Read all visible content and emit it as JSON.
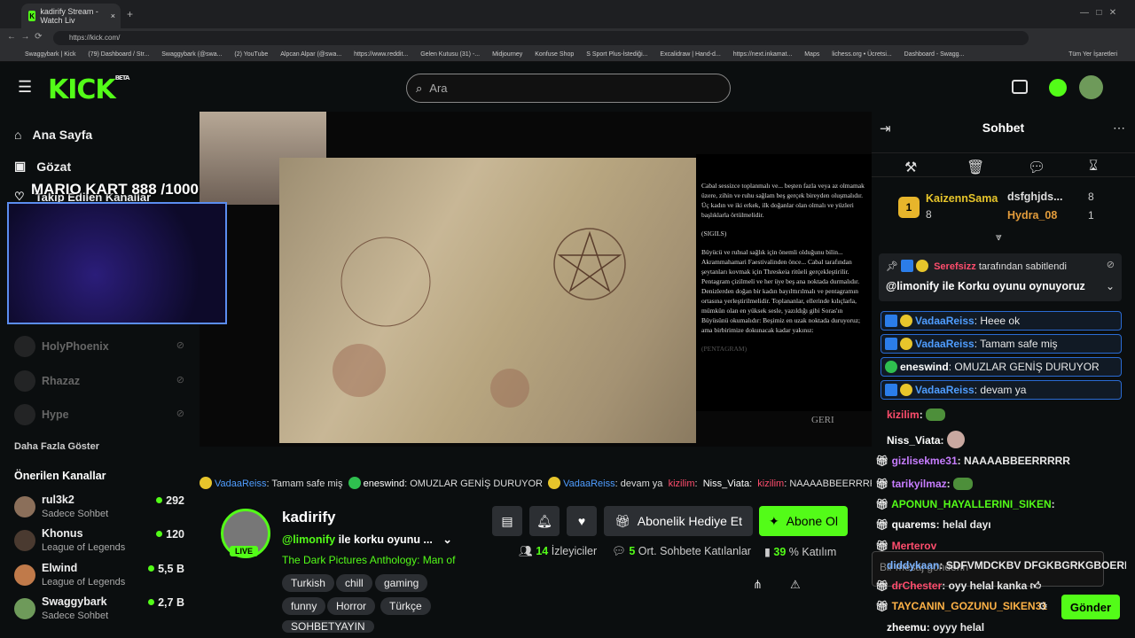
{
  "browser": {
    "tab_title": "kadirify Stream - Watch Liv",
    "url": "https://kick.com/",
    "bookmarks": [
      "Swaggybark | Kick",
      "(79) Dashboard / Str...",
      "Swaggybark (@swa...",
      "(2) YouTube",
      "Alpcan Alpar (@swa...",
      "https://www.reddit...",
      "Gelen Kutusu (31) -...",
      "Midjourney",
      "Konfuse Shop",
      "S Sport Plus-İstediği...",
      "Excalidraw | Hand-d...",
      "https://next.inkamat...",
      "Maps",
      "lichess.org • Ücretsi...",
      "Dashboard - Swagg..."
    ],
    "all_bookmarks": "Tüm Yer İşaretleri"
  },
  "header": {
    "logo": "KICK",
    "logo_beta": "BETA",
    "search_placeholder": "Ara"
  },
  "sidebar": {
    "nav": [
      "Ana Sayfa",
      "Gözat",
      "Takip Edilen Kanallar"
    ],
    "offline_channels": [
      "HolyPhoenix",
      "Rhazaz",
      "Hype"
    ],
    "show_more": "Daha Fazla Göster",
    "recommended_title": "Önerilen Kanallar",
    "recommended": [
      {
        "name": "rul3k2",
        "game": "Sadece Sohbet",
        "viewers": "292"
      },
      {
        "name": "Khonus",
        "game": "League of Legends",
        "viewers": "120"
      },
      {
        "name": "Elwind",
        "game": "League of Legends",
        "viewers": "5,5 B"
      },
      {
        "name": "Swaggybark",
        "game": "Sadece Sohbet",
        "viewers": "2,7 B"
      }
    ]
  },
  "video": {
    "score_overlay": "MARIO KART   888 /1000",
    "book_text_1": "Cabal sessizce toplanmalı ve... beşten fazla veya az olmamak üzere, zihin ve ruhu sağlam beş gerçek bireyden oluşmalıdır. Üç kadın ve iki erkek, ilk doğanlar olan olmalı ve yüzleri başlıklarla örtülmelidir.",
    "book_sigils": "(SIGILS)",
    "book_text_2": "Büyücü ve ruhsal sağlık için önemli olduğunu bilin... Akrammahamari Faestivalinden önce... Cabal tarafından şeytanları kovmak için Threskeia ritüeli gerçekleştirilir. Pentagram çizilmeli ve her üye beş ana noktada durmalıdır. Denizlerden doğan bir kadın bayılttırılmalı ve pentagramın ortasına yerleştirilmelidir. Toplananlar, ellerinde kılıçlarla, mümkün olan en yüksek sesle, yazıldığı gibi Soras'ın Büyüsünü okumalıdır: Beşimiz en uzak noktada duruyoruz; ama birbirimize dokunacak kadar yakınız:",
    "book_pentagram": "(PENTAGRAM)",
    "back_label": "GERI"
  },
  "overlay_strip": {
    "m1_user": "VadaaReiss",
    "m1_text": "Tamam safe miş",
    "m2_user": "eneswind",
    "m2_text": "OMUZLAR GENİŞ DURUYOR",
    "m3_user": "VadaaReiss",
    "m3_text": "devam ya",
    "m4_user": "kizilim",
    "m5_user": "Niss_Viata",
    "m6_user": "kizilim",
    "m6_text": "NAAAABBEERRRR"
  },
  "stream": {
    "channel": "kadirify",
    "live": "LIVE",
    "title_mention": "@limonify",
    "title_rest": " ile korku oyunu ...",
    "category": "The Dark Pictures Anthology: Man of Medan",
    "tags": [
      "Turkish",
      "chill",
      "gaming",
      "funny",
      "Horror",
      "Türkçe",
      "SOHBETYAYIN"
    ],
    "gift_sub": "Abonelik Hediye Et",
    "subscribe": "Abone Ol",
    "viewers": "14",
    "viewers_label": "İzleyiciler",
    "chatters": "5",
    "chatters_label": "Ort. Sohbete Katılanlar",
    "participation": "39",
    "participation_label": "% Katılım"
  },
  "chat": {
    "title": "Sohbet",
    "leader1_rank": "1",
    "leader1_name": "KaizennSama",
    "leader1_count": "8",
    "leader2_name": "dsfghjds...",
    "leader2_count": "8",
    "leader3_name": "Hydra_08",
    "leader3_count": "1",
    "pinned_by": "Serefsizz",
    "pinned_by_suffix": "tarafından sabitlendi",
    "pinned_text": "@limonify ile Korku oyunu oynuyoruz",
    "boxed": [
      {
        "user": "VadaaReiss",
        "text": "Heee ok"
      },
      {
        "user": "VadaaReiss",
        "text": "Tamam safe miş"
      },
      {
        "user": "eneswind",
        "text": "OMUZLAR GENİŞ DURUYOR"
      },
      {
        "user": "VadaaReiss",
        "text": "devam ya"
      }
    ],
    "messages": [
      {
        "user": "kizilim",
        "text": ":",
        "color": "#ff4d6d"
      },
      {
        "user": "Niss_Viata",
        "text": ":",
        "color": "#ffffff"
      },
      {
        "user": "gizlisekme31",
        "text": ": NAAAABBEERRRRR",
        "color": "#c77dff"
      },
      {
        "user": "tarikyilmaz",
        "text": ":",
        "color": "#c77dff"
      },
      {
        "user": "APONUN_HAYALLERINI_SIKEN",
        "text": ":",
        "color": "#53fc18"
      },
      {
        "user": "quarems",
        "text": ": helal dayı",
        "color": "#ffffff"
      },
      {
        "user": "Merterov",
        "text": "",
        "color": "#ff4d6d"
      },
      {
        "user": "diddykaan",
        "text": ": SDFVMDCKBV DFGKBGRKGBOERFMDÖGB",
        "color": "#7bb3ff"
      },
      {
        "user": "drChester",
        "text": ": oyy helal kanka",
        "color": "#ff4d6d"
      },
      {
        "user": "TAYCANIN_GOZUNU_SIKEN31",
        "text": "",
        "color": "#ffb347"
      },
      {
        "user": "zheemu",
        "text": ": oyyy helal",
        "color": "#ffffff"
      }
    ],
    "input_placeholder": "Bir mesaj gönderin",
    "send": "Gönder"
  },
  "colors": {
    "accent": "#53fc18",
    "bg": "#0b0e0f"
  }
}
